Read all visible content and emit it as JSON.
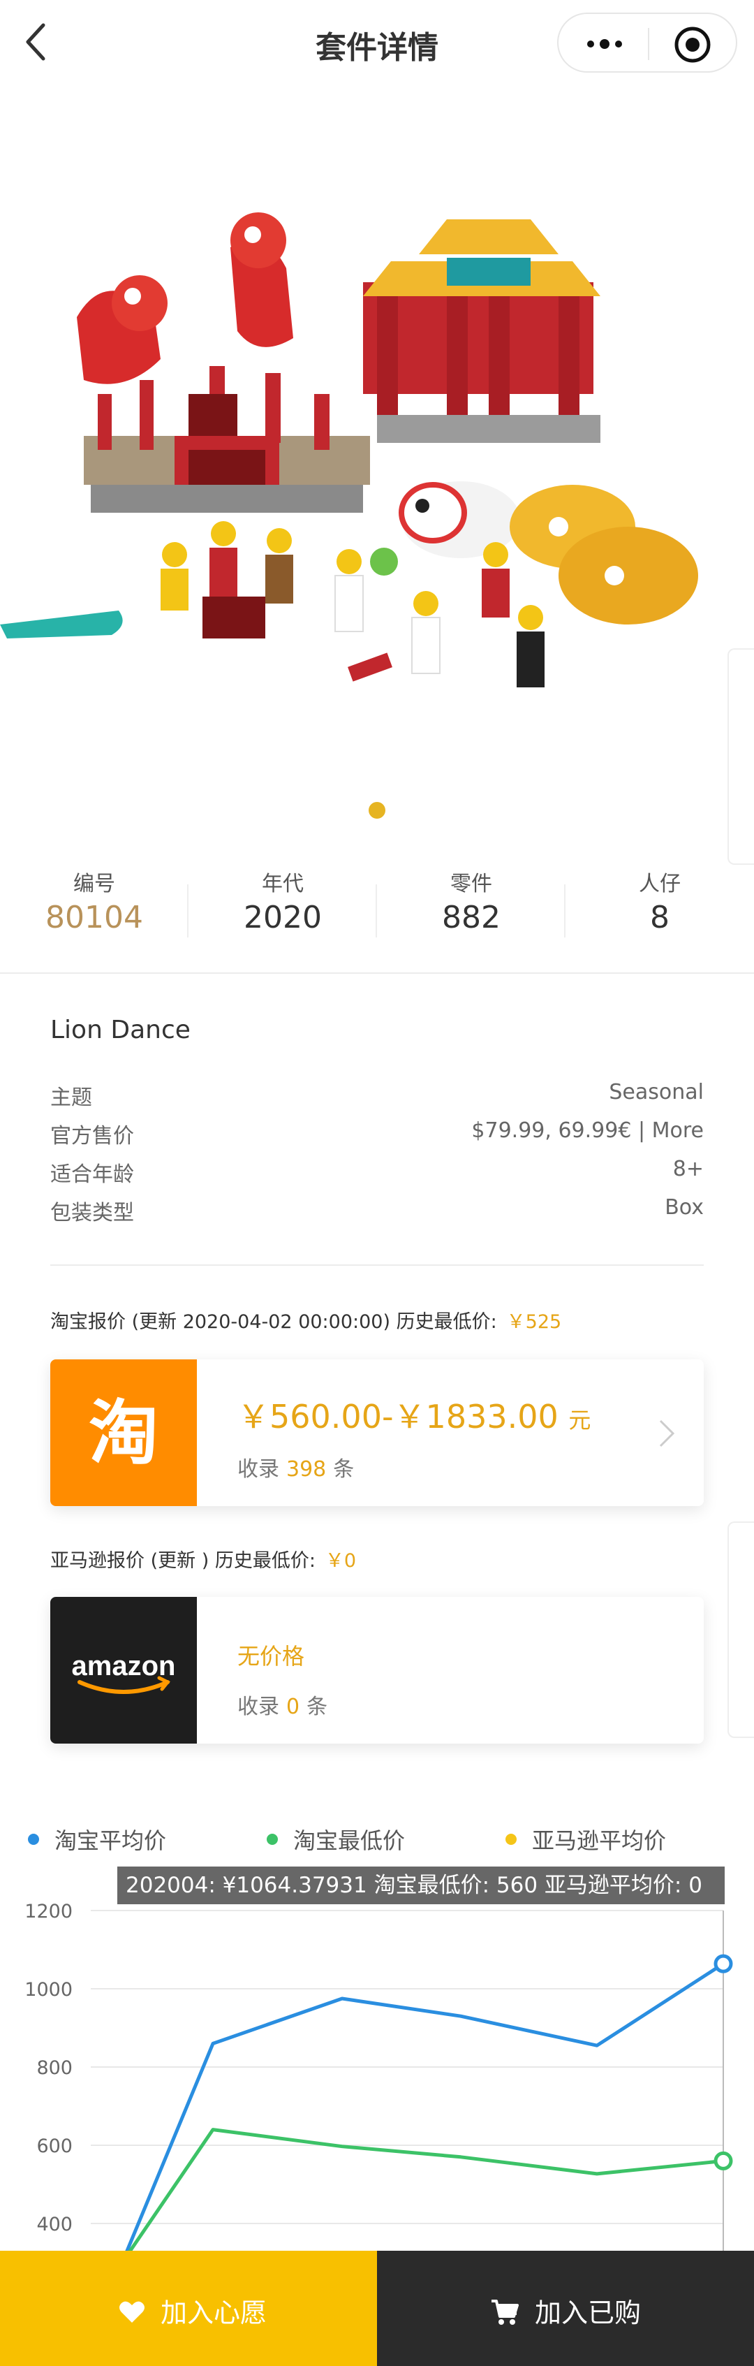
{
  "navbar": {
    "title": "套件详情"
  },
  "stats": [
    {
      "label": "编号",
      "value": "80104"
    },
    {
      "label": "年代",
      "value": "2020"
    },
    {
      "label": "零件",
      "value": "882"
    },
    {
      "label": "人仔",
      "value": "8"
    }
  ],
  "set": {
    "name": "Lion Dance",
    "info": [
      {
        "key": "主题",
        "value": "Seasonal"
      },
      {
        "key": "官方售价",
        "value": "$79.99, 69.99€ | More"
      },
      {
        "key": "适合年龄",
        "value": "8+"
      },
      {
        "key": "包装类型",
        "value": "Box"
      }
    ]
  },
  "taobao": {
    "header": "淘宝报价 (更新 2020-04-02 00:00:00) 历史最低价:",
    "lowest": "￥525",
    "logo_char": "淘",
    "price": "￥560.00-￥1833.00",
    "unit": "元",
    "count_prefix": "收录",
    "count": "398",
    "count_suffix": "条"
  },
  "amazon": {
    "header": "亚马逊报价 (更新 ) 历史最低价:",
    "lowest": "￥0",
    "logo_text": "amazon",
    "no_price": "无价格",
    "count_prefix": "收录",
    "count": "0",
    "count_suffix": "条"
  },
  "colors": {
    "gold": "#e6a517",
    "price_gold": "#b8925a",
    "taobao_orange": "#ff8c00",
    "wish_yellow": "#f8c000",
    "dark": "#2b2b2b"
  },
  "chart_data": {
    "type": "line",
    "y_ticks": [
      "1200",
      "1000",
      "800",
      "600",
      "400"
    ],
    "ylim": [
      400,
      1200
    ],
    "grid": true,
    "legend_position": "top",
    "series": [
      {
        "name": "淘宝平均价",
        "color": "#2a8ee0",
        "values": [
          300,
          860,
          975,
          930,
          855,
          1064
        ]
      },
      {
        "name": "淘宝最低价",
        "color": "#3cc267",
        "values": [
          300,
          640,
          597,
          570,
          527,
          560
        ]
      },
      {
        "name": "亚马逊平均价",
        "color": "#f5c518",
        "values": [
          0,
          0,
          0,
          0,
          0,
          0
        ]
      }
    ],
    "tooltip": "202004: ¥1064.37931   淘宝最低价: 560   亚马逊平均价: 0"
  },
  "bottom": {
    "wish_label": "加入心愿",
    "bought_label": "加入已购"
  }
}
